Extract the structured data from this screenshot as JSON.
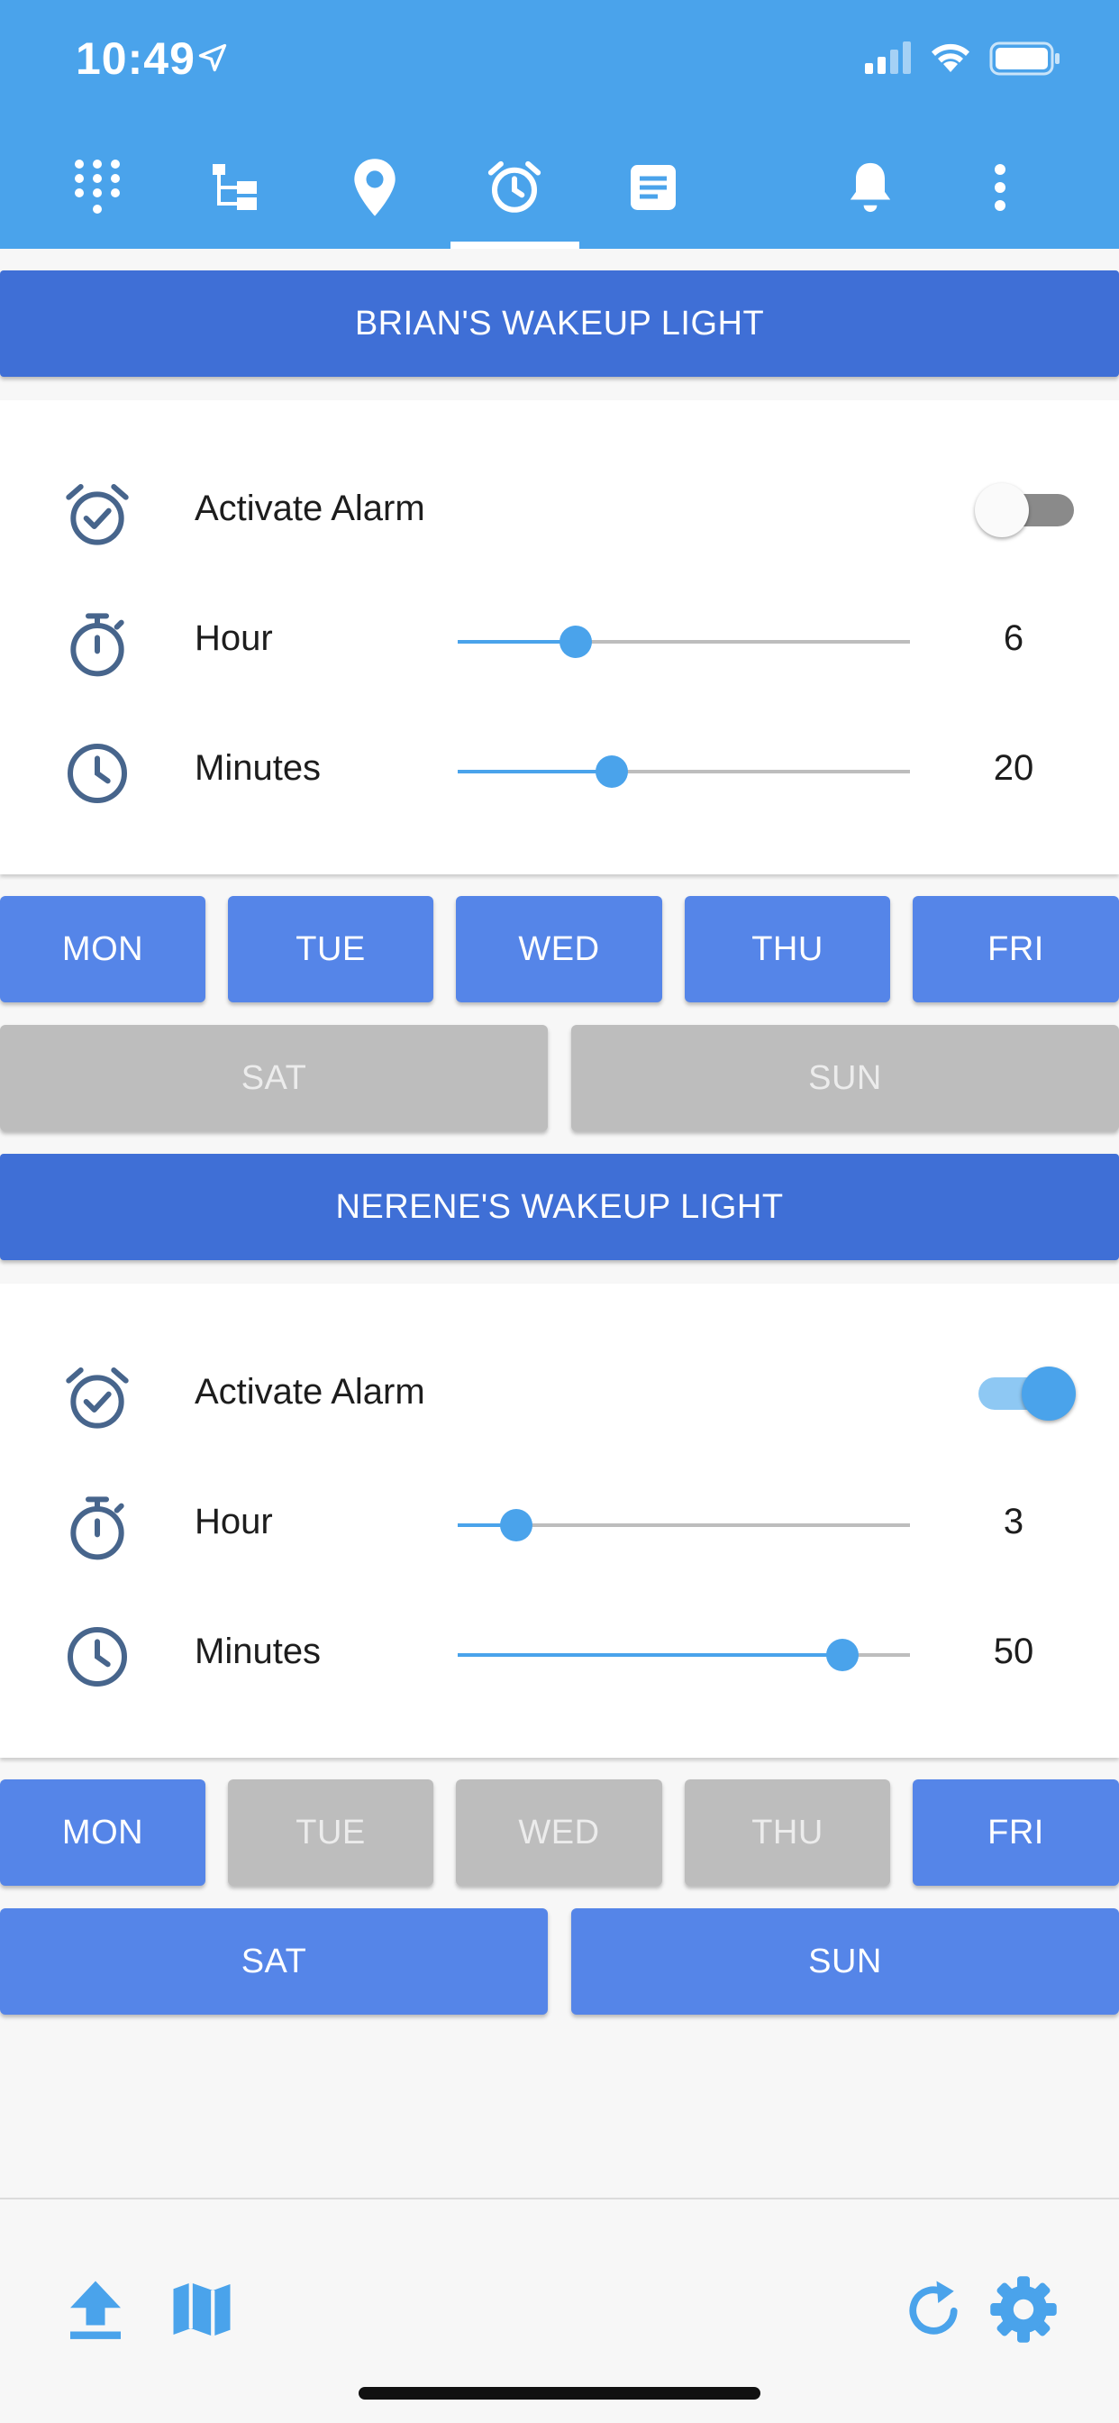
{
  "status_bar": {
    "time": "10:49"
  },
  "toolbar": {
    "icons": [
      "dialpad-icon",
      "tree-icon",
      "location-pin-icon",
      "alarm-icon",
      "notes-icon",
      "bell-icon",
      "more-vert-icon"
    ],
    "active_tab": "alarm-icon"
  },
  "colors": {
    "app_bar": "#4aa3eb",
    "header": "#3f6fd6",
    "day_on": "#5585e8",
    "day_off": "#bdbdbd",
    "accent": "#4aa3eb"
  },
  "alarms": [
    {
      "title": "BRIAN'S WAKEUP LIGHT",
      "activate_label": "Activate Alarm",
      "active": false,
      "hour_label": "Hour",
      "hour_value": "6",
      "hour_fraction": 0.26,
      "minutes_label": "Minutes",
      "minutes_value": "20",
      "minutes_fraction": 0.34,
      "days": [
        {
          "label": "MON",
          "on": true
        },
        {
          "label": "TUE",
          "on": true
        },
        {
          "label": "WED",
          "on": true
        },
        {
          "label": "THU",
          "on": true
        },
        {
          "label": "FRI",
          "on": true
        },
        {
          "label": "SAT",
          "on": false
        },
        {
          "label": "SUN",
          "on": false
        }
      ]
    },
    {
      "title": "NERENE'S WAKEUP LIGHT",
      "activate_label": "Activate Alarm",
      "active": true,
      "hour_label": "Hour",
      "hour_value": "3",
      "hour_fraction": 0.13,
      "minutes_label": "Minutes",
      "minutes_value": "50",
      "minutes_fraction": 0.85,
      "days": [
        {
          "label": "MON",
          "on": true
        },
        {
          "label": "TUE",
          "on": false
        },
        {
          "label": "WED",
          "on": false
        },
        {
          "label": "THU",
          "on": false
        },
        {
          "label": "FRI",
          "on": true
        },
        {
          "label": "SAT",
          "on": true
        },
        {
          "label": "SUN",
          "on": true
        }
      ]
    }
  ],
  "bottom_bar": {
    "icons": [
      "upload-icon",
      "map-icon",
      "refresh-icon",
      "settings-icon"
    ]
  }
}
